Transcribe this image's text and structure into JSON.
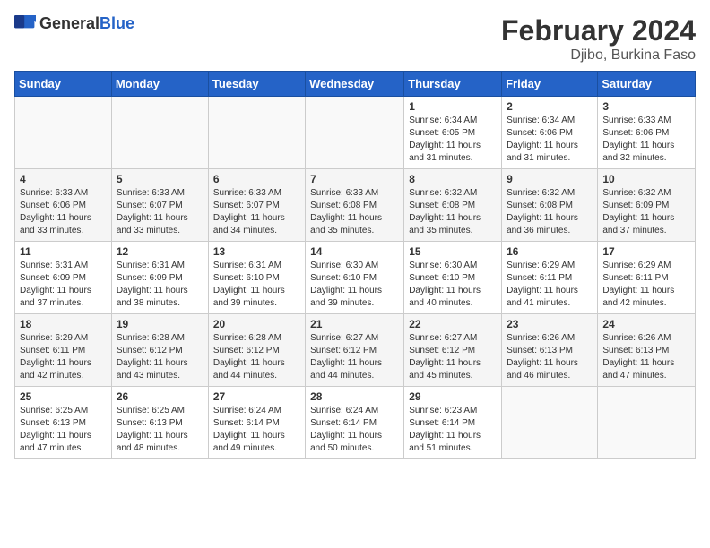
{
  "header": {
    "logo_general": "General",
    "logo_blue": "Blue",
    "title": "February 2024",
    "location": "Djibo, Burkina Faso"
  },
  "weekdays": [
    "Sunday",
    "Monday",
    "Tuesday",
    "Wednesday",
    "Thursday",
    "Friday",
    "Saturday"
  ],
  "weeks": [
    [
      {
        "day": "",
        "info": ""
      },
      {
        "day": "",
        "info": ""
      },
      {
        "day": "",
        "info": ""
      },
      {
        "day": "",
        "info": ""
      },
      {
        "day": "1",
        "info": "Sunrise: 6:34 AM\nSunset: 6:05 PM\nDaylight: 11 hours\nand 31 minutes."
      },
      {
        "day": "2",
        "info": "Sunrise: 6:34 AM\nSunset: 6:06 PM\nDaylight: 11 hours\nand 31 minutes."
      },
      {
        "day": "3",
        "info": "Sunrise: 6:33 AM\nSunset: 6:06 PM\nDaylight: 11 hours\nand 32 minutes."
      }
    ],
    [
      {
        "day": "4",
        "info": "Sunrise: 6:33 AM\nSunset: 6:06 PM\nDaylight: 11 hours\nand 33 minutes."
      },
      {
        "day": "5",
        "info": "Sunrise: 6:33 AM\nSunset: 6:07 PM\nDaylight: 11 hours\nand 33 minutes."
      },
      {
        "day": "6",
        "info": "Sunrise: 6:33 AM\nSunset: 6:07 PM\nDaylight: 11 hours\nand 34 minutes."
      },
      {
        "day": "7",
        "info": "Sunrise: 6:33 AM\nSunset: 6:08 PM\nDaylight: 11 hours\nand 35 minutes."
      },
      {
        "day": "8",
        "info": "Sunrise: 6:32 AM\nSunset: 6:08 PM\nDaylight: 11 hours\nand 35 minutes."
      },
      {
        "day": "9",
        "info": "Sunrise: 6:32 AM\nSunset: 6:08 PM\nDaylight: 11 hours\nand 36 minutes."
      },
      {
        "day": "10",
        "info": "Sunrise: 6:32 AM\nSunset: 6:09 PM\nDaylight: 11 hours\nand 37 minutes."
      }
    ],
    [
      {
        "day": "11",
        "info": "Sunrise: 6:31 AM\nSunset: 6:09 PM\nDaylight: 11 hours\nand 37 minutes."
      },
      {
        "day": "12",
        "info": "Sunrise: 6:31 AM\nSunset: 6:09 PM\nDaylight: 11 hours\nand 38 minutes."
      },
      {
        "day": "13",
        "info": "Sunrise: 6:31 AM\nSunset: 6:10 PM\nDaylight: 11 hours\nand 39 minutes."
      },
      {
        "day": "14",
        "info": "Sunrise: 6:30 AM\nSunset: 6:10 PM\nDaylight: 11 hours\nand 39 minutes."
      },
      {
        "day": "15",
        "info": "Sunrise: 6:30 AM\nSunset: 6:10 PM\nDaylight: 11 hours\nand 40 minutes."
      },
      {
        "day": "16",
        "info": "Sunrise: 6:29 AM\nSunset: 6:11 PM\nDaylight: 11 hours\nand 41 minutes."
      },
      {
        "day": "17",
        "info": "Sunrise: 6:29 AM\nSunset: 6:11 PM\nDaylight: 11 hours\nand 42 minutes."
      }
    ],
    [
      {
        "day": "18",
        "info": "Sunrise: 6:29 AM\nSunset: 6:11 PM\nDaylight: 11 hours\nand 42 minutes."
      },
      {
        "day": "19",
        "info": "Sunrise: 6:28 AM\nSunset: 6:12 PM\nDaylight: 11 hours\nand 43 minutes."
      },
      {
        "day": "20",
        "info": "Sunrise: 6:28 AM\nSunset: 6:12 PM\nDaylight: 11 hours\nand 44 minutes."
      },
      {
        "day": "21",
        "info": "Sunrise: 6:27 AM\nSunset: 6:12 PM\nDaylight: 11 hours\nand 44 minutes."
      },
      {
        "day": "22",
        "info": "Sunrise: 6:27 AM\nSunset: 6:12 PM\nDaylight: 11 hours\nand 45 minutes."
      },
      {
        "day": "23",
        "info": "Sunrise: 6:26 AM\nSunset: 6:13 PM\nDaylight: 11 hours\nand 46 minutes."
      },
      {
        "day": "24",
        "info": "Sunrise: 6:26 AM\nSunset: 6:13 PM\nDaylight: 11 hours\nand 47 minutes."
      }
    ],
    [
      {
        "day": "25",
        "info": "Sunrise: 6:25 AM\nSunset: 6:13 PM\nDaylight: 11 hours\nand 47 minutes."
      },
      {
        "day": "26",
        "info": "Sunrise: 6:25 AM\nSunset: 6:13 PM\nDaylight: 11 hours\nand 48 minutes."
      },
      {
        "day": "27",
        "info": "Sunrise: 6:24 AM\nSunset: 6:14 PM\nDaylight: 11 hours\nand 49 minutes."
      },
      {
        "day": "28",
        "info": "Sunrise: 6:24 AM\nSunset: 6:14 PM\nDaylight: 11 hours\nand 50 minutes."
      },
      {
        "day": "29",
        "info": "Sunrise: 6:23 AM\nSunset: 6:14 PM\nDaylight: 11 hours\nand 51 minutes."
      },
      {
        "day": "",
        "info": ""
      },
      {
        "day": "",
        "info": ""
      }
    ]
  ]
}
